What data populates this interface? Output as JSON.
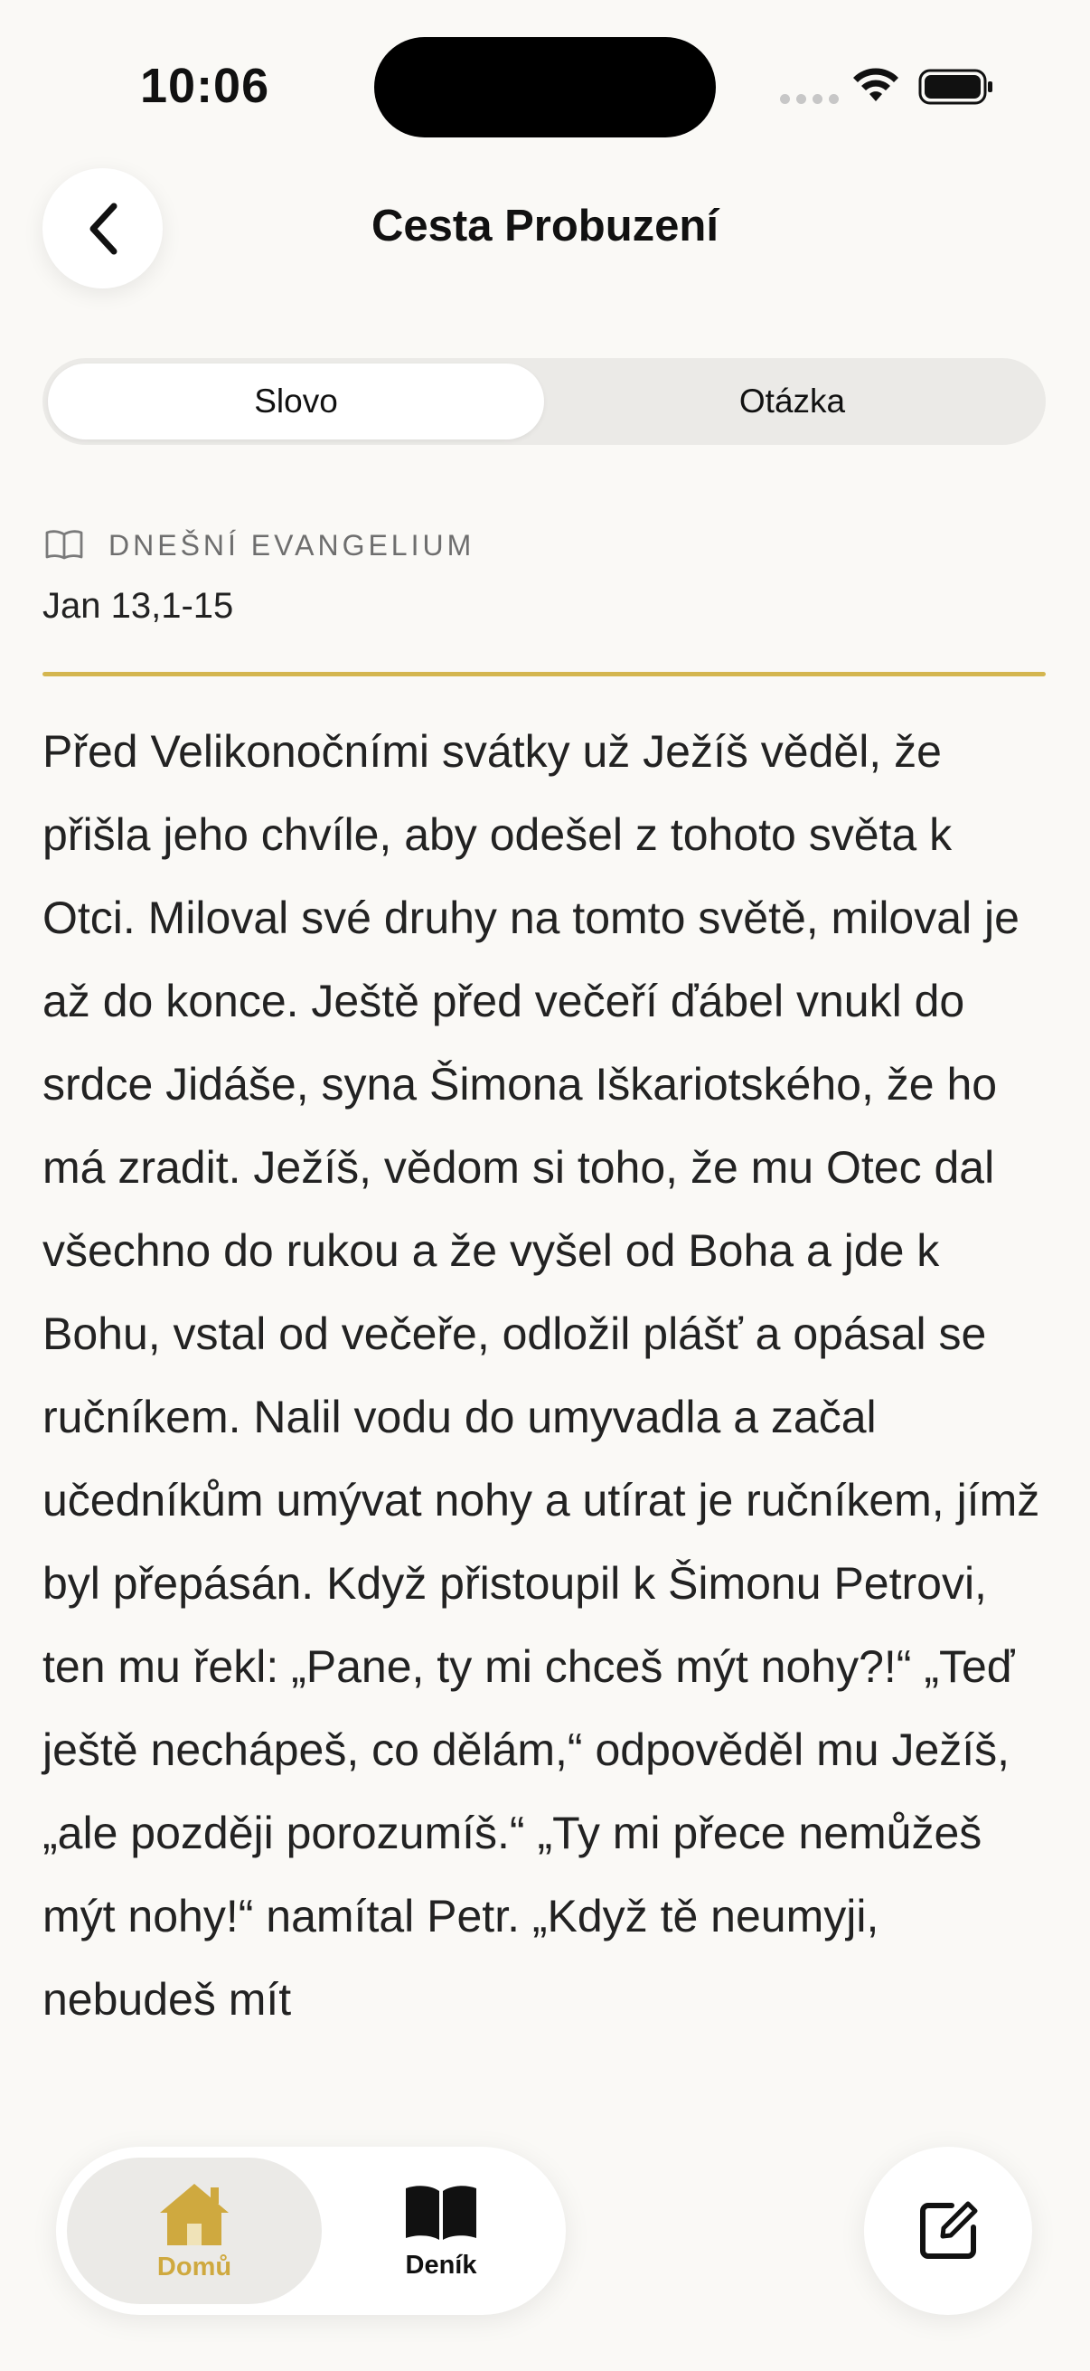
{
  "status_bar": {
    "time": "10:06"
  },
  "header": {
    "title": "Cesta Probuzení"
  },
  "segmented": {
    "tabs": [
      {
        "label": "Slovo",
        "active": true
      },
      {
        "label": "Otázka",
        "active": false
      }
    ]
  },
  "gospel": {
    "section_label": "DNEŠNÍ EVANGELIUM",
    "reference": "Jan 13,1-15",
    "text": "Před Velikonočními svátky už Ježíš věděl, že přišla jeho chvíle, aby odešel z tohoto světa k Otci. Miloval své druhy na tomto světě, miloval je až do konce. Ještě před večeří ďábel vnukl do srdce Jidáše, syna Šimona Iškariotského, že ho má zradit. Ježíš, vědom si toho, že mu Otec dal všechno do rukou a že vyšel od Boha a jde k Bohu, vstal od večeře, odložil plášť a opásal se ručníkem. Nalil vodu do umyvadla a začal učedníkům umývat nohy a utírat je ručníkem, jímž byl přepásán. Když přistoupil k Šimonu Petrovi, ten mu řekl: „Pane, ty mi chceš mýt nohy?!“ „Teď ještě nechápeš, co dělám,“ odpověděl mu Ježíš, „ale později porozumíš.“ „Ty mi přece nemůžeš mýt nohy!“ namítal Petr. „Když tě neumyji, nebudeš mít"
  },
  "tab_bar": {
    "items": [
      {
        "label": "Domů",
        "icon": "house-icon",
        "active": true
      },
      {
        "label": "Deník",
        "icon": "open-book-icon",
        "active": false
      }
    ],
    "compose_icon": "compose-icon"
  },
  "colors": {
    "accent": "#d4b64f",
    "background": "#faf9f6",
    "segment_bg": "#ebeae7"
  }
}
